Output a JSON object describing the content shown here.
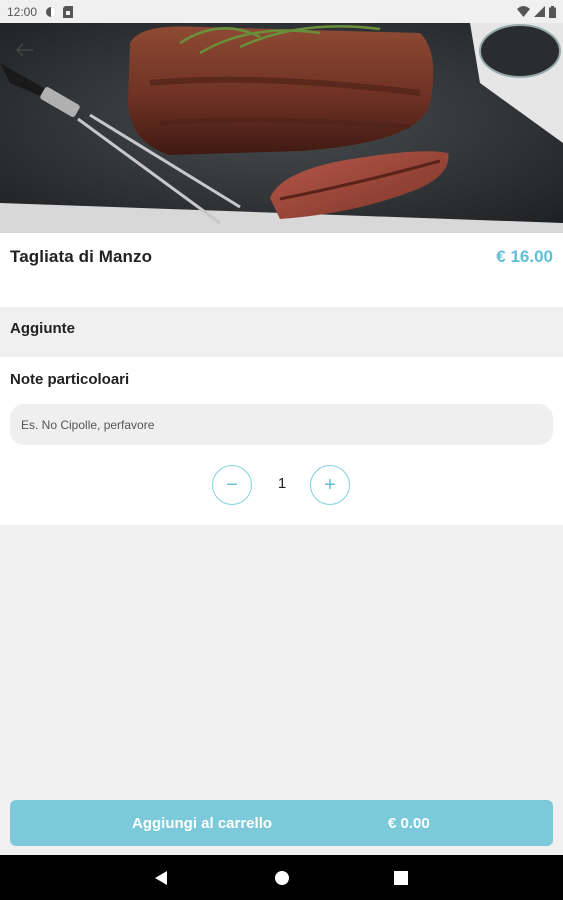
{
  "status_bar": {
    "time": "12:00",
    "icons": [
      "settings-icon",
      "sim-card-icon",
      "wifi-icon",
      "signal-icon",
      "battery-icon"
    ]
  },
  "hero": {
    "image": "grilled-steak-photo",
    "back_icon": "arrow-left-icon"
  },
  "product": {
    "name": "Tagliata di Manzo",
    "price": "€ 16.00"
  },
  "extras": {
    "label": "Aggiunte"
  },
  "notes": {
    "label": "Note particoloari",
    "value": "",
    "placeholder": "Es. No Cipolle, perfavore"
  },
  "quantity": {
    "value": "1",
    "minus_symbol": "−",
    "plus_symbol": "+"
  },
  "cart_button": {
    "label": "Aggiungi al carrello",
    "total": "€ 0.00"
  },
  "colors": {
    "accent": "#5fbfd4",
    "cart_button": "#7ccad9",
    "background": "#f0f0f0"
  },
  "nav_bar": {
    "icons": [
      "back-triangle-icon",
      "home-circle-icon",
      "recents-square-icon"
    ]
  }
}
